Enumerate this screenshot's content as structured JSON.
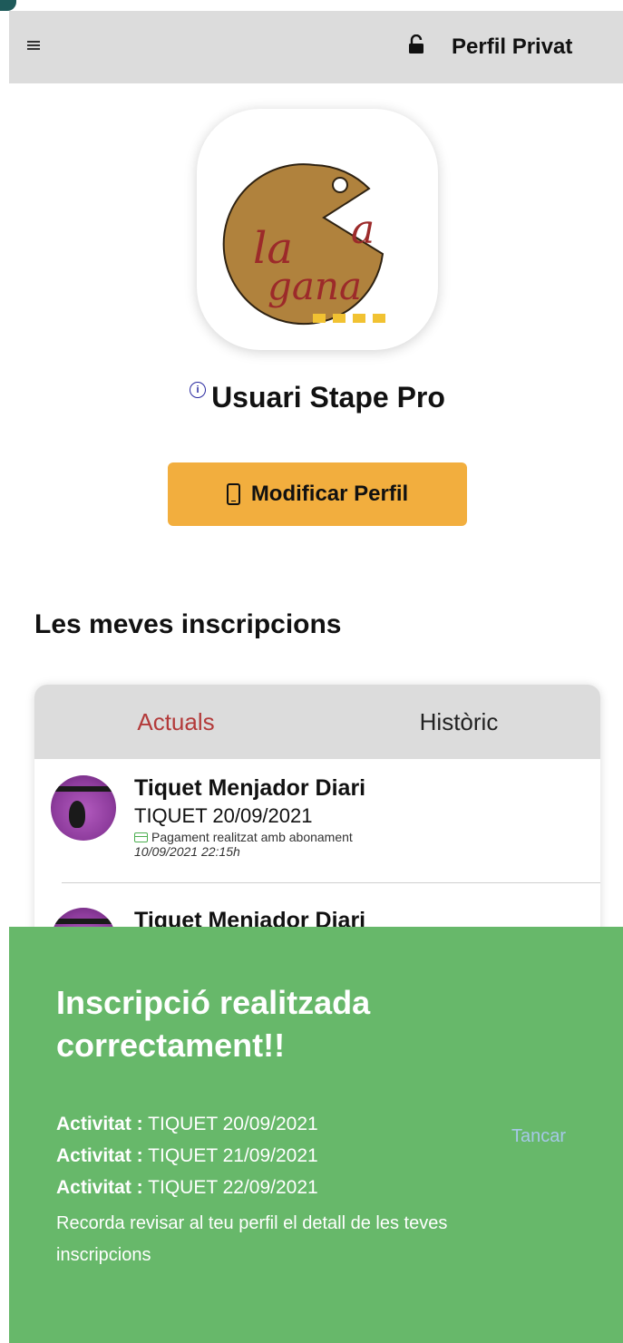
{
  "header": {
    "title": "Perfil Privat",
    "menu_icon": "hamburger-menu-icon",
    "lock_icon": "unlocked-padlock-icon"
  },
  "profile": {
    "name": "Usuari Stape Pro",
    "info_icon": "info-icon",
    "logo_text_top": "a",
    "logo_text_mid": "la",
    "logo_text_bottom": "gana",
    "edit_button_label": "Modificar Perfil",
    "edit_button_icon": "phone-icon"
  },
  "registrations": {
    "section_title": "Les meves inscripcions",
    "tabs": [
      {
        "label": "Actuals",
        "active": true
      },
      {
        "label": "Històric",
        "active": false
      }
    ],
    "items": [
      {
        "title": "Tiquet Menjador Diari",
        "subtitle": "TIQUET 20/09/2021",
        "payment": "Pagament realitzat amb abonament",
        "date": "10/09/2021 22:15h"
      },
      {
        "title": "Tiquet Menjador Diari"
      }
    ]
  },
  "toast": {
    "title": "Inscripció realitzada correctament!!",
    "lines": [
      {
        "label": "Activitat :",
        "value": "TIQUET 20/09/2021"
      },
      {
        "label": "Activitat :",
        "value": "TIQUET 21/09/2021"
      },
      {
        "label": "Activitat :",
        "value": "TIQUET 22/09/2021"
      }
    ],
    "close_label": "Tancar",
    "note": "Recorda revisar al teu perfil el detall de les teves inscripcions"
  },
  "colors": {
    "header_bg": "#dcdcdc",
    "button_bg": "#f2ae3e",
    "active_tab": "#b33a3a",
    "toast_bg": "#67b86a",
    "close_link": "#a6c8e8"
  }
}
